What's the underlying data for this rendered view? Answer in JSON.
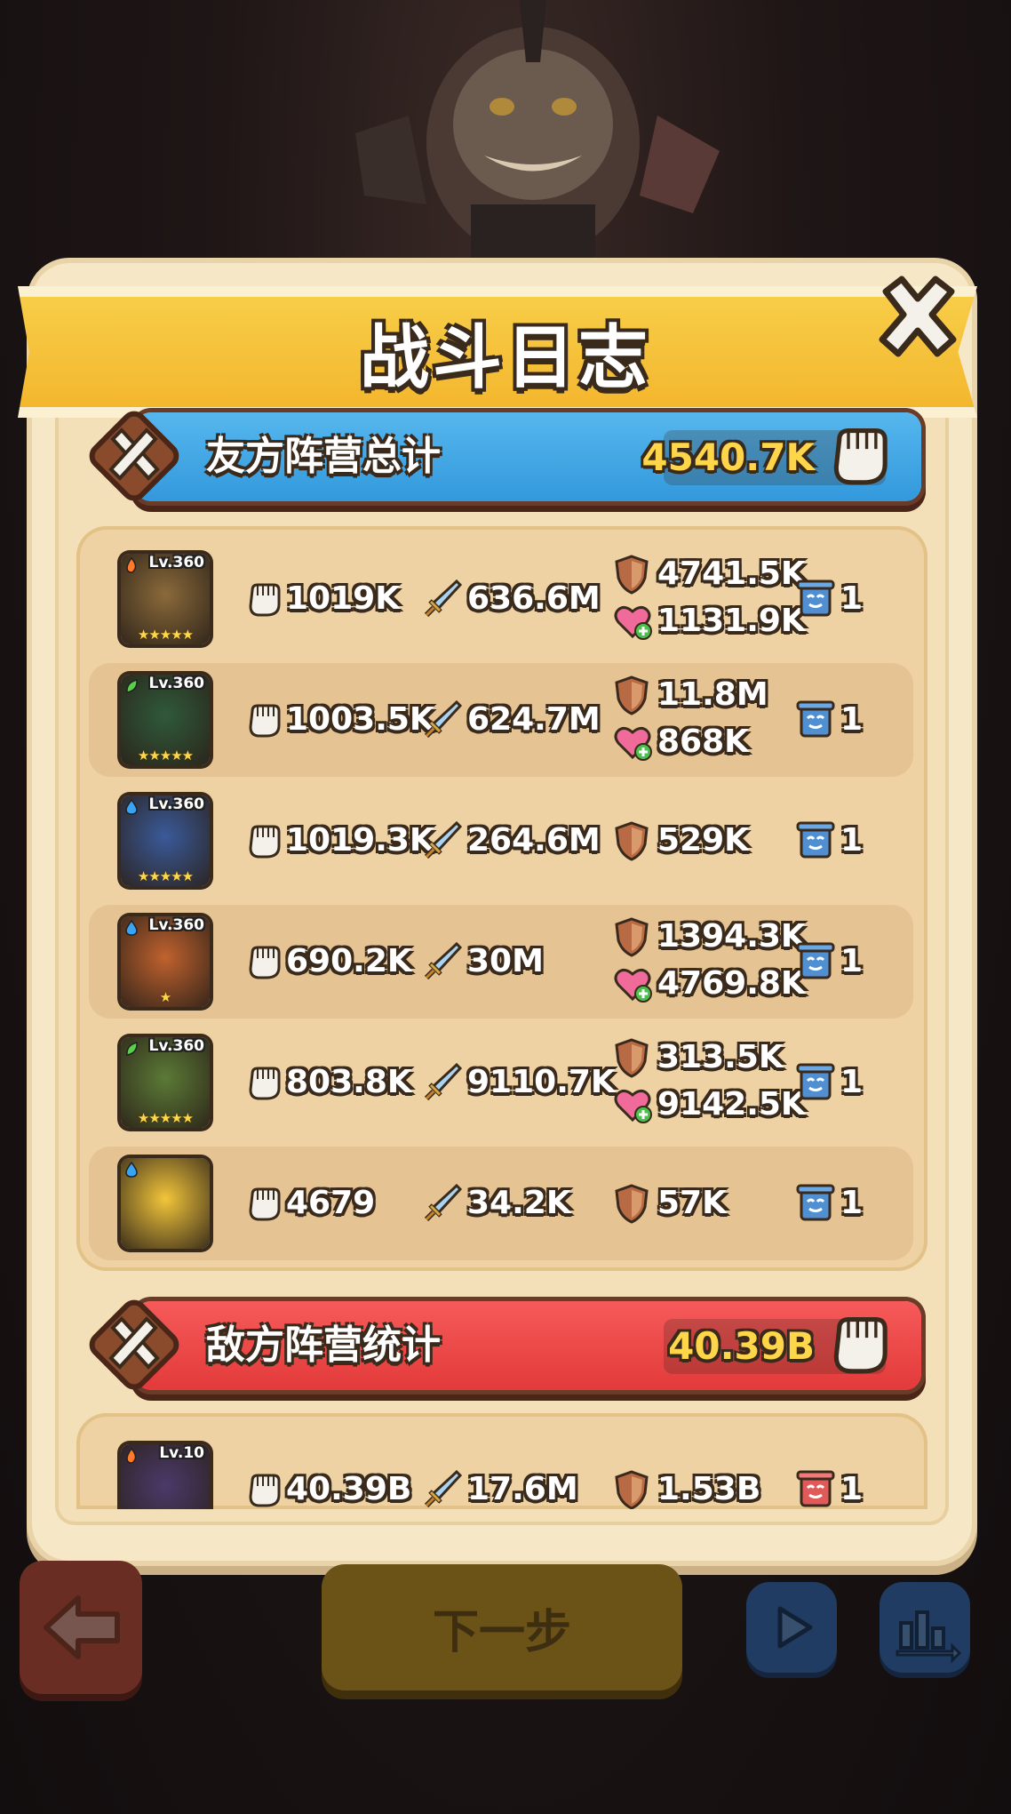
{
  "title": "战斗日志",
  "friendly": {
    "label": "友方阵营总计",
    "total": "4540.7K",
    "color": "#3aa4e4",
    "heroes": [
      {
        "level": "Lv.360",
        "element": "fire",
        "stars": "★★★★★",
        "portrait_color": "#8a6a3a",
        "damage": "1019K",
        "dps_sword": "636.6M",
        "defense": "4741.5K",
        "heal": "1131.9K",
        "count": "1"
      },
      {
        "level": "Lv.360",
        "element": "nature",
        "stars": "★★★★★",
        "portrait_color": "#2f5a3a",
        "damage": "1003.5K",
        "dps_sword": "624.7M",
        "defense": "11.8M",
        "heal": "868K",
        "count": "1"
      },
      {
        "level": "Lv.360",
        "element": "water",
        "stars": "★★★★★",
        "portrait_color": "#3a5a9a",
        "damage": "1019.3K",
        "dps_sword": "264.6M",
        "defense": "529K",
        "heal": "",
        "count": "1"
      },
      {
        "level": "Lv.360",
        "element": "water",
        "stars": "★",
        "portrait_color": "#c0622e",
        "damage": "690.2K",
        "dps_sword": "30M",
        "defense": "1394.3K",
        "heal": "4769.8K",
        "count": "1"
      },
      {
        "level": "Lv.360",
        "element": "nature",
        "stars": "★★★★★",
        "portrait_color": "#5b7a36",
        "damage": "803.8K",
        "dps_sword": "9110.7K",
        "defense": "313.5K",
        "heal": "9142.5K",
        "count": "1"
      },
      {
        "level": "",
        "element": "water",
        "stars": "",
        "portrait_color": "#f2c53a",
        "damage": "4679",
        "dps_sword": "34.2K",
        "defense": "57K",
        "heal": "",
        "count": "1"
      }
    ]
  },
  "enemy": {
    "label": "敌方阵营统计",
    "total": "40.39B",
    "color": "#e84545",
    "heroes": [
      {
        "level": "Lv.10",
        "element": "fire",
        "stars": "",
        "portrait_color": "#4a3a6a",
        "damage": "40.39B",
        "dps_sword": "17.6M",
        "defense": "1.53B",
        "heal": "",
        "count": "1"
      }
    ]
  },
  "buttons": {
    "next": "下一步"
  },
  "icons": {
    "damage": "fist-icon",
    "sword": "sword-icon",
    "defense": "shield-icon",
    "heal": "heart-plus-icon",
    "count": "scroll-icon",
    "close": "close-icon",
    "back": "arrow-left-icon",
    "play": "play-icon",
    "stats": "stats-icon"
  }
}
